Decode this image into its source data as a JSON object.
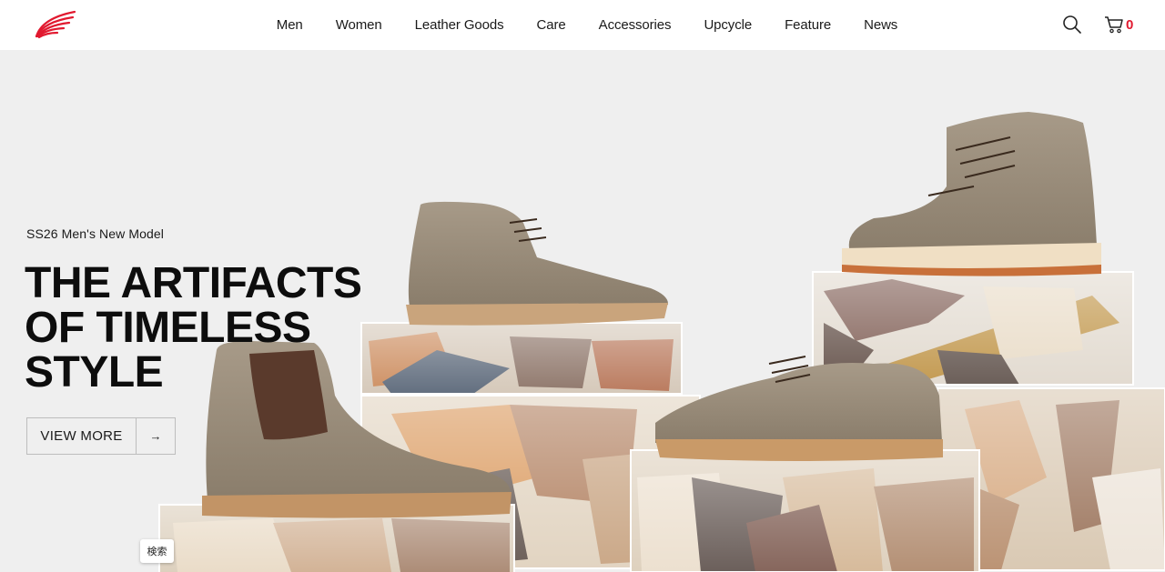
{
  "brand": {
    "logo_icon": "red-wing-logo-icon",
    "accent_color": "#e1192f"
  },
  "nav": {
    "items": [
      {
        "label": "Men"
      },
      {
        "label": "Women"
      },
      {
        "label": "Leather Goods"
      },
      {
        "label": "Care"
      },
      {
        "label": "Accessories"
      },
      {
        "label": "Upcycle"
      },
      {
        "label": "Feature"
      },
      {
        "label": "News"
      }
    ]
  },
  "header": {
    "search_icon": "search-icon",
    "cart_icon": "cart-icon",
    "cart_count": "0"
  },
  "hero": {
    "eyebrow": "SS26 Men's New Model",
    "headline_lines": [
      "THE ARTIFACTS",
      "OF TIMELESS",
      "STYLE"
    ],
    "cta_label": "VIEW MORE",
    "cta_arrow": "→"
  },
  "search_chip": {
    "label": "検索"
  }
}
